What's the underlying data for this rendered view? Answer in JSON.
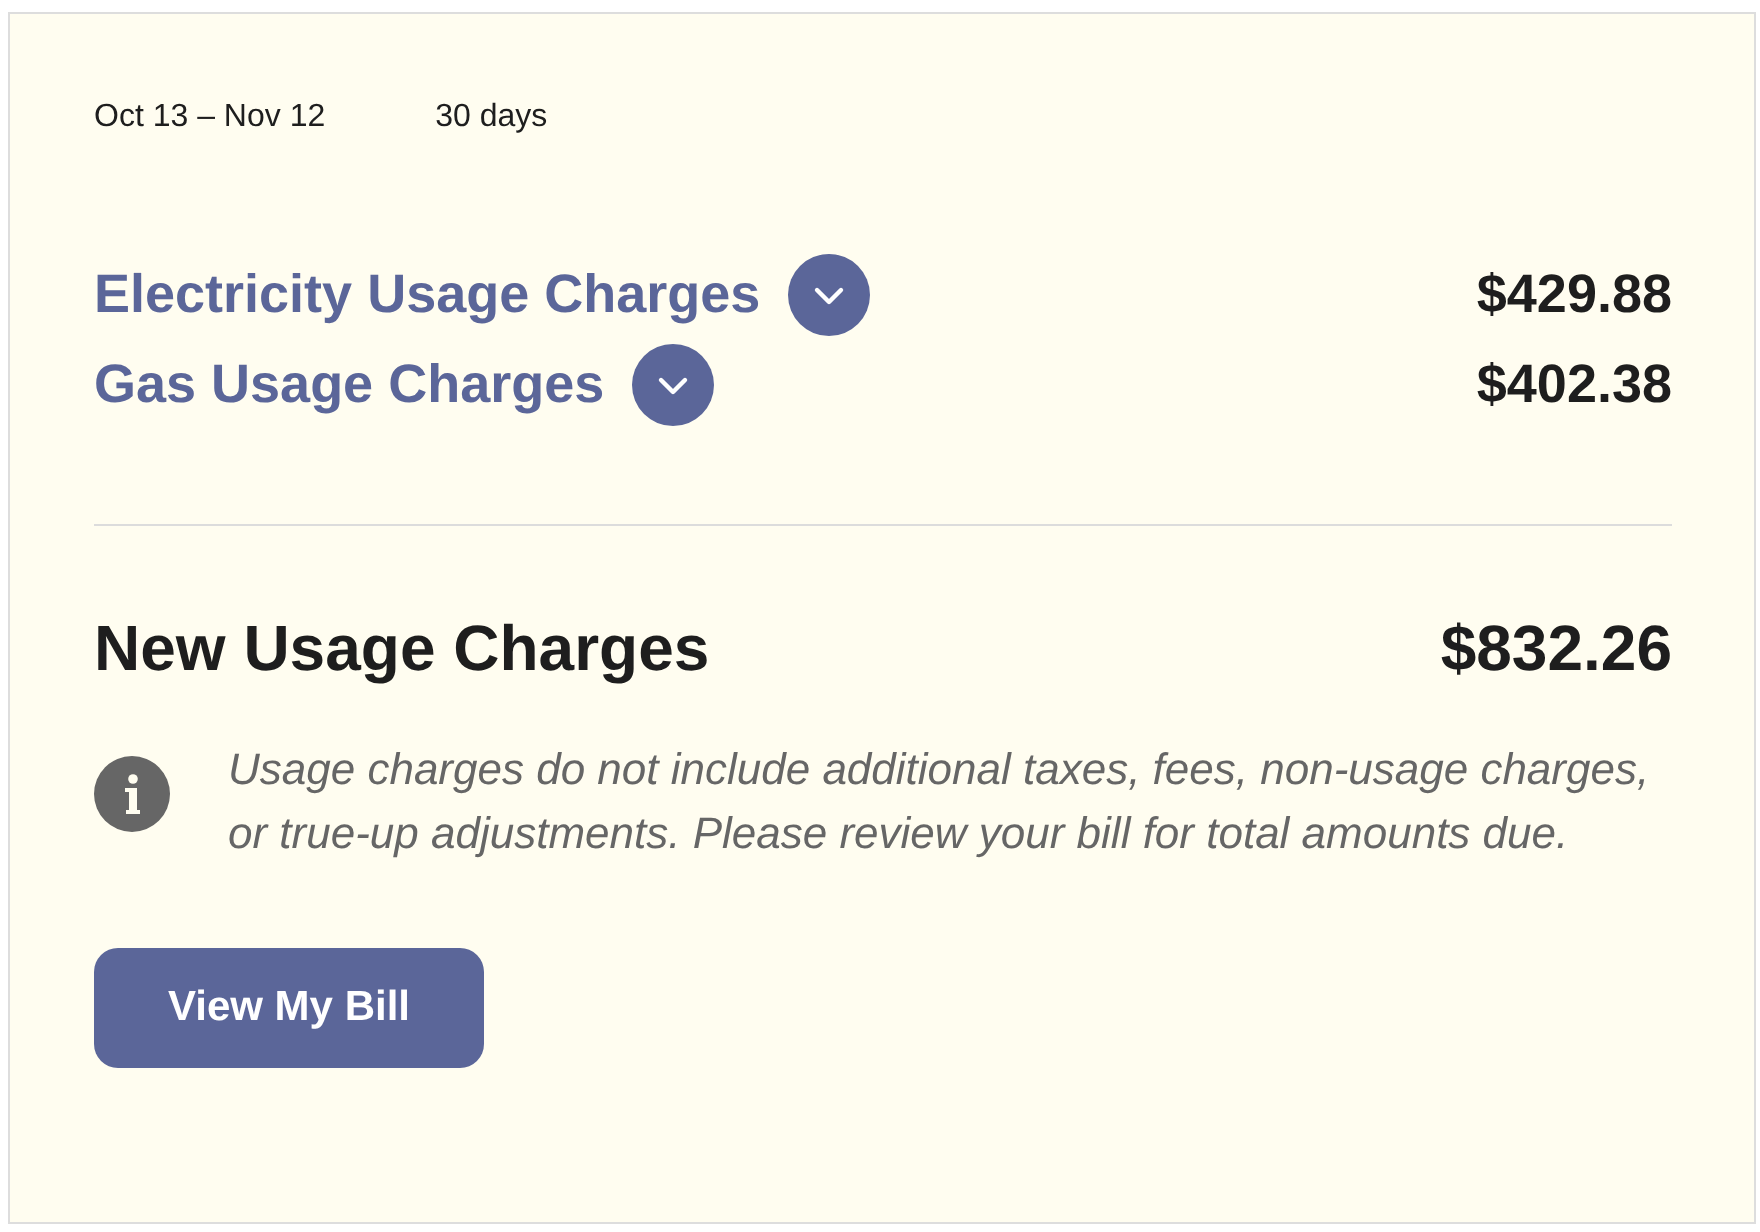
{
  "period": {
    "dates": "Oct 13 – Nov 12",
    "duration": "30 days"
  },
  "charges": [
    {
      "label": "Electricity Usage Charges",
      "amount": "$429.88",
      "expanded": false
    },
    {
      "label": "Gas Usage Charges",
      "amount": "$402.38",
      "expanded": false
    }
  ],
  "total": {
    "label": "New Usage Charges",
    "amount": "$832.26"
  },
  "notice": {
    "text": "Usage charges do not include additional taxes, fees, non-usage charges, or true-up adjustments. Please review your bill for total amounts due."
  },
  "button": {
    "label": "View My Bill"
  }
}
